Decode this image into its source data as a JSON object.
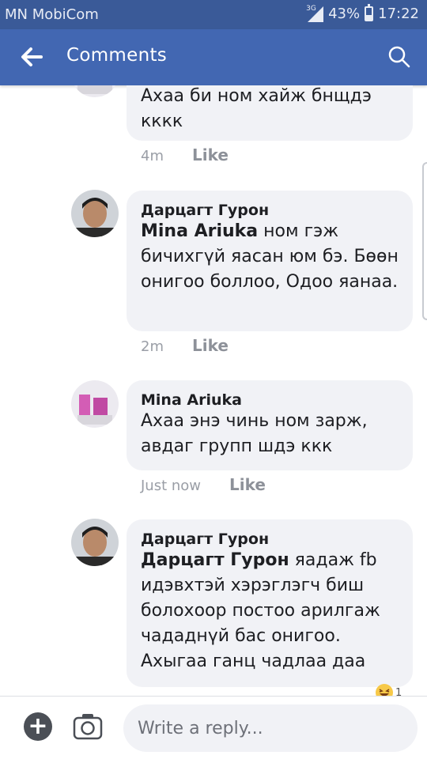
{
  "status_bar": {
    "carrier": "MN MobiCom",
    "network": "3G",
    "battery": "43%",
    "time": "17:22"
  },
  "app_bar": {
    "title": "Comments",
    "back_icon": "arrow-back-icon",
    "search_icon": "search-icon"
  },
  "comments": [
    {
      "author": "",
      "text": "Ахаа би ном хайж бнщдэ кккк",
      "time": "4m",
      "like_label": "Like"
    },
    {
      "author": "Дарцагт Гурон",
      "mention": "Mina Ariuka",
      "text": " ном гэж бичихгүй яасан юм бэ. Бөөн онигоо боллоо, Одоо яанаа.",
      "time": "2m",
      "like_label": "Like"
    },
    {
      "author": "Mina Ariuka",
      "text": "Ахаа энэ чинь ном зарж, авдаг групп шдэ ккк",
      "time": "Just now",
      "like_label": "Like"
    },
    {
      "author": "Дарцагт Гурон",
      "mention": "Дарцагт Гурон",
      "text": " яадаж fb идэвхтэй  хэрэглэгч биш болохоор постоо арилгаж чададнүй бас онигоо. Ахыгаа ганц чадлаа даа",
      "reaction_count": "1"
    }
  ],
  "reply_bar": {
    "placeholder": "Write a reply...",
    "add_icon": "plus-icon",
    "camera_icon": "camera-icon"
  },
  "colors": {
    "status_bar": "#3a5a98",
    "app_bar": "#4267b2",
    "bubble": "#f1f2f6"
  }
}
